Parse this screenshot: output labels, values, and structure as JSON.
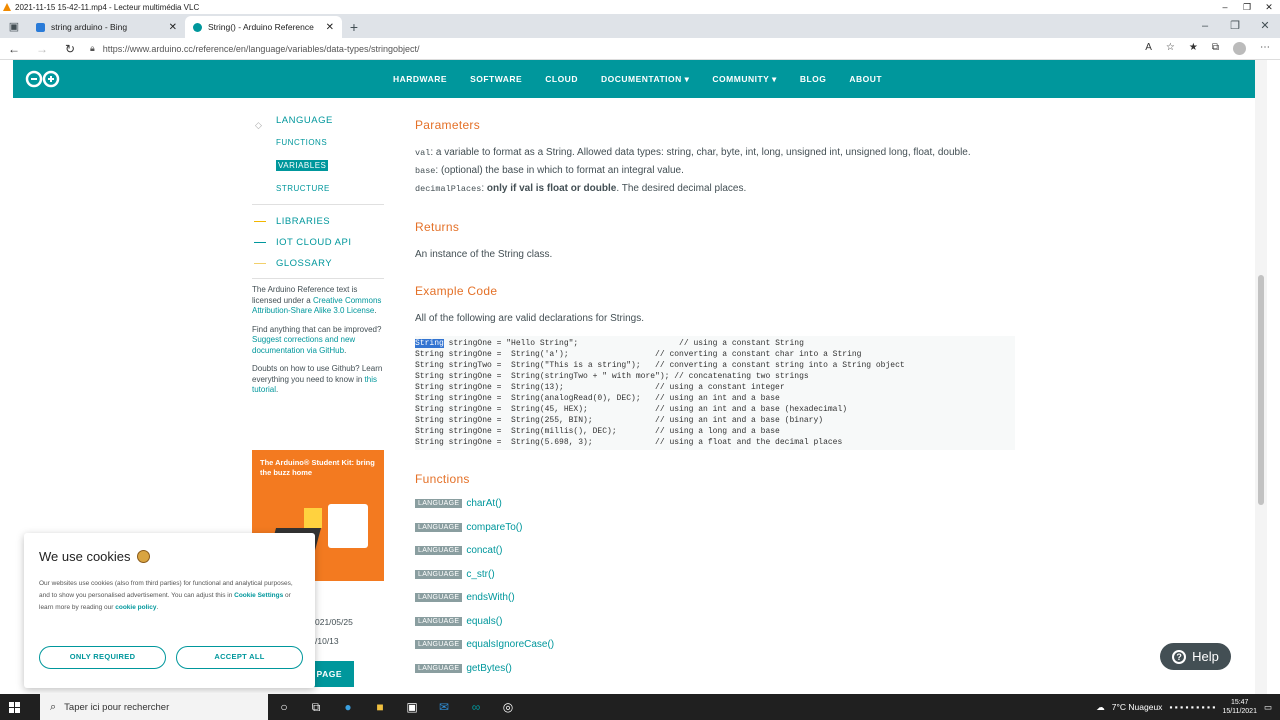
{
  "vlc": {
    "title": "2021-11-15 15-42-11.mp4 - Lecteur multimédia VLC"
  },
  "browser": {
    "tabs": [
      {
        "label": "string arduino - Bing",
        "active": false
      },
      {
        "label": "String() - Arduino Reference",
        "active": true
      }
    ],
    "url": "https://www.arduino.cc/reference/en/language/variables/data-types/stringobject/"
  },
  "nav": {
    "items": [
      "HARDWARE",
      "SOFTWARE",
      "CLOUD",
      "DOCUMENTATION",
      "COMMUNITY",
      "BLOG",
      "ABOUT"
    ]
  },
  "sidebar": {
    "language": "LANGUAGE",
    "sub": [
      "FUNCTIONS",
      "VARIABLES",
      "STRUCTURE"
    ],
    "libraries": "LIBRARIES",
    "iot": "IOT CLOUD API",
    "glossary": "GLOSSARY",
    "license_pre": "The Arduino Reference text is licensed under a ",
    "license_link": "Creative Commons Attribution-Share Alike 3.0 License",
    "license_post": ".",
    "improve_pre": "Find anything that can be improved? ",
    "improve_link": "Suggest corrections and new documentation via GitHub",
    "improve_post": ".",
    "github_pre": "Doubts on how to use Github? Learn everything you need to know in ",
    "github_link": "this tutorial",
    "github_post": ".",
    "promo": "The Arduino® Student Kit: bring the buzz home",
    "meta1": "021/05/25",
    "meta2": "/10/13",
    "btn": "PAGE"
  },
  "main": {
    "parameters_title": "Parameters",
    "param_val_code": "val",
    "param_val_text": ": a variable to format as a String. Allowed data types: string, char, byte, int, long, unsigned int, unsigned long, float, double.",
    "param_base_code": "base",
    "param_base_text": ": (optional) the base in which to format an integral value.",
    "param_dp_code": "decimalPlaces",
    "param_dp_sep": ": ",
    "param_dp_bold": "only if val is float or double",
    "param_dp_text": ". The desired decimal places.",
    "returns_title": "Returns",
    "returns_text": "An instance of the String class.",
    "example_title": "Example Code",
    "example_text": "All of the following are valid declarations for Strings.",
    "code_selected": "String",
    "code_lines": [
      " stringOne = \"Hello String\";                     // using a constant String",
      "String stringOne =  String('a');                  // converting a constant char into a String",
      "String stringTwo =  String(\"This is a string\");   // converting a constant string into a String object",
      "String stringOne =  String(stringTwo + \" with more\"); // concatenating two strings",
      "String stringOne =  String(13);                   // using a constant integer",
      "String stringOne =  String(analogRead(0), DEC);   // using an int and a base",
      "String stringOne =  String(45, HEX);              // using an int and a base (hexadecimal)",
      "String stringOne =  String(255, BIN);             // using an int and a base (binary)",
      "String stringOne =  String(millis(), DEC);        // using a long and a base",
      "String stringOne =  String(5.698, 3);             // using a float and the decimal places"
    ],
    "functions_title": "Functions",
    "functions_tag": "LANGUAGE",
    "functions": [
      "charAt()",
      "compareTo()",
      "concat()",
      "c_str()",
      "endsWith()",
      "equals()",
      "equalsIgnoreCase()",
      "getBytes()"
    ]
  },
  "cookie": {
    "title": "We use cookies",
    "body_pre": "Our websites use cookies (also from third parties) for functional and analytical purposes, and to show you personalised advertisement. You can adjust this in ",
    "settings": "Cookie Settings",
    "body_mid": " or learn more by reading our ",
    "policy": "cookie policy",
    "body_post": ".",
    "only_required": "ONLY REQUIRED",
    "accept_all": "ACCEPT ALL"
  },
  "help": {
    "label": "Help"
  },
  "taskbar": {
    "search_placeholder": "Taper ici pour rechercher",
    "weather": "7°C  Nuageux",
    "time": "15:47",
    "date": "15/11/2021"
  }
}
